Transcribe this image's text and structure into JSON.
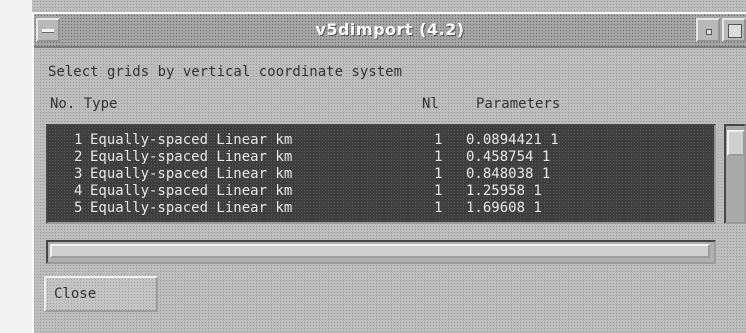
{
  "window": {
    "title": "v5dimport (4.2)"
  },
  "instruction": "Select grids by vertical coordinate system",
  "columns": {
    "no_type": "No. Type",
    "nl": "Nl",
    "parameters": "Parameters"
  },
  "rows": [
    {
      "no": "1",
      "type": "Equally-spaced Linear km",
      "nl": "1",
      "params": "0.0894421 1"
    },
    {
      "no": "2",
      "type": "Equally-spaced Linear km",
      "nl": "1",
      "params": "0.458754 1"
    },
    {
      "no": "3",
      "type": "Equally-spaced Linear km",
      "nl": "1",
      "params": "0.848038 1"
    },
    {
      "no": "4",
      "type": "Equally-spaced Linear km",
      "nl": "1",
      "params": "1.25958 1"
    },
    {
      "no": "5",
      "type": "Equally-spaced Linear km",
      "nl": "1",
      "params": "1.69608 1"
    }
  ],
  "buttons": {
    "close": "Close"
  }
}
